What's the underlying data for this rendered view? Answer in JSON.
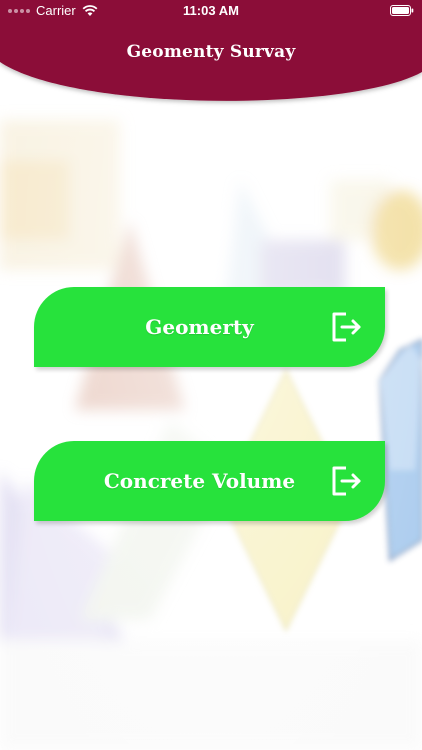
{
  "status_bar": {
    "carrier": "Carrier",
    "time": "11:03 AM",
    "wifi_icon": "wifi-icon",
    "battery_icon": "battery-icon"
  },
  "header": {
    "title": "Geomenty Survay",
    "color": "#8b1138"
  },
  "menu": {
    "button_color": "#27e23c",
    "items": [
      {
        "label": "Geomerty",
        "icon": "logout-arrow-icon"
      },
      {
        "label": "Concrete Volume",
        "icon": "logout-arrow-icon"
      }
    ]
  }
}
